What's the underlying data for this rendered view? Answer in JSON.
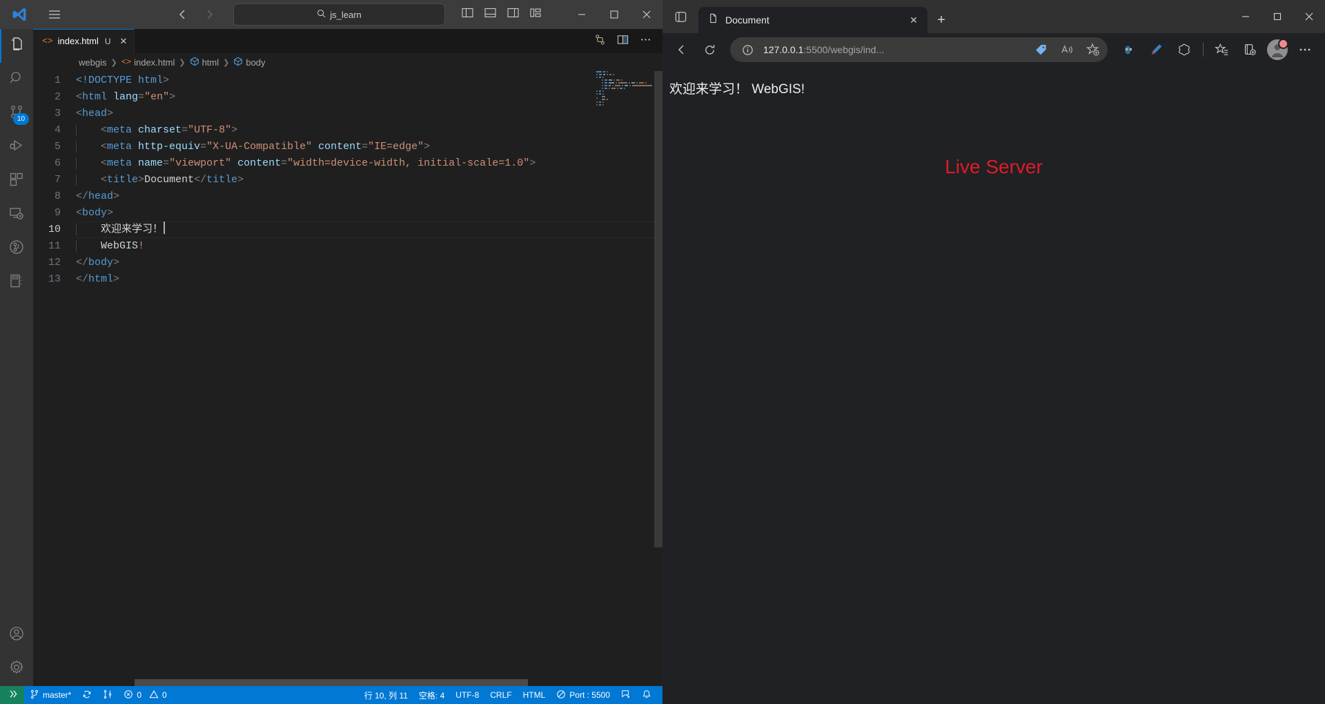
{
  "vscode": {
    "titlebar": {
      "search_value": "js_learn",
      "search_icon": "search-icon",
      "hamburger_icon": "hamburger-menu-icon",
      "logo_icon": "vscode-logo-icon",
      "back_icon": "back-arrow-icon",
      "forward_icon": "forward-arrow-icon",
      "layout_icons": [
        "toggle-primary-sidebar-icon",
        "toggle-panel-icon",
        "toggle-secondary-sidebar-icon",
        "customize-layout-icon"
      ],
      "window_controls": [
        "minimize",
        "maximize",
        "close"
      ]
    },
    "activitybar": {
      "items": [
        {
          "name": "explorer",
          "icon": "files-icon",
          "active": true,
          "badge": ""
        },
        {
          "name": "search",
          "icon": "search-icon",
          "active": false,
          "badge": ""
        },
        {
          "name": "source-control",
          "icon": "source-control-icon",
          "active": false,
          "badge": "10"
        },
        {
          "name": "run-and-debug",
          "icon": "run-debug-icon",
          "active": false,
          "badge": ""
        },
        {
          "name": "extensions",
          "icon": "extensions-icon",
          "active": false,
          "badge": ""
        },
        {
          "name": "remote-explorer",
          "icon": "remote-explorer-icon",
          "active": false,
          "badge": ""
        },
        {
          "name": "git-graph",
          "icon": "git-graph-icon",
          "active": false,
          "badge": ""
        },
        {
          "name": "notebook",
          "icon": "notebook-icon",
          "active": false,
          "badge": ""
        }
      ],
      "bottom_items": [
        {
          "name": "accounts",
          "icon": "account-icon"
        },
        {
          "name": "manage",
          "icon": "gear-icon"
        }
      ]
    },
    "tab": {
      "label": "index.html",
      "dirty_indicator": "U",
      "close_label": "✕",
      "file_icon": "html-file-icon",
      "actions": [
        "split-editor-down-icon",
        "split-editor-right-icon",
        "more-actions-icon"
      ]
    },
    "breadcrumbs": [
      {
        "label": "webgis",
        "icon": ""
      },
      {
        "label": "index.html",
        "icon": "html-file-icon"
      },
      {
        "label": "html",
        "icon": "symbol-field-icon"
      },
      {
        "label": "body",
        "icon": "symbol-field-icon"
      }
    ],
    "code": {
      "lines": [
        {
          "n": "1",
          "indent": 0,
          "tokens": [
            {
              "t": "doctype",
              "v": "<!DOCTYPE "
            },
            {
              "t": "tag",
              "v": "html"
            },
            {
              "t": "punct",
              "v": ">"
            }
          ]
        },
        {
          "n": "2",
          "indent": 0,
          "tokens": [
            {
              "t": "punct",
              "v": "<"
            },
            {
              "t": "tag",
              "v": "html "
            },
            {
              "t": "attr",
              "v": "lang"
            },
            {
              "t": "punct",
              "v": "="
            },
            {
              "t": "str",
              "v": "\"en\""
            },
            {
              "t": "punct",
              "v": ">"
            }
          ]
        },
        {
          "n": "3",
          "indent": 0,
          "tokens": [
            {
              "t": "punct",
              "v": "<"
            },
            {
              "t": "tag",
              "v": "head"
            },
            {
              "t": "punct",
              "v": ">"
            }
          ]
        },
        {
          "n": "4",
          "indent": 1,
          "tokens": [
            {
              "t": "punct",
              "v": "<"
            },
            {
              "t": "tag",
              "v": "meta "
            },
            {
              "t": "attr",
              "v": "charset"
            },
            {
              "t": "punct",
              "v": "="
            },
            {
              "t": "str",
              "v": "\"UTF-8\""
            },
            {
              "t": "punct",
              "v": ">"
            }
          ]
        },
        {
          "n": "5",
          "indent": 1,
          "tokens": [
            {
              "t": "punct",
              "v": "<"
            },
            {
              "t": "tag",
              "v": "meta "
            },
            {
              "t": "attr",
              "v": "http-equiv"
            },
            {
              "t": "punct",
              "v": "="
            },
            {
              "t": "str",
              "v": "\"X-UA-Compatible\""
            },
            {
              "t": "txt",
              "v": " "
            },
            {
              "t": "attr",
              "v": "content"
            },
            {
              "t": "punct",
              "v": "="
            },
            {
              "t": "str",
              "v": "\"IE=edge\""
            },
            {
              "t": "punct",
              "v": ">"
            }
          ]
        },
        {
          "n": "6",
          "indent": 1,
          "tokens": [
            {
              "t": "punct",
              "v": "<"
            },
            {
              "t": "tag",
              "v": "meta "
            },
            {
              "t": "attr",
              "v": "name"
            },
            {
              "t": "punct",
              "v": "="
            },
            {
              "t": "str",
              "v": "\"viewport\""
            },
            {
              "t": "txt",
              "v": " "
            },
            {
              "t": "attr",
              "v": "content"
            },
            {
              "t": "punct",
              "v": "="
            },
            {
              "t": "str",
              "v": "\"width=device-width, initial-scale=1.0\""
            },
            {
              "t": "punct",
              "v": ">"
            }
          ]
        },
        {
          "n": "7",
          "indent": 1,
          "tokens": [
            {
              "t": "punct",
              "v": "<"
            },
            {
              "t": "tag",
              "v": "title"
            },
            {
              "t": "punct",
              "v": ">"
            },
            {
              "t": "white",
              "v": "Document"
            },
            {
              "t": "punct",
              "v": "</"
            },
            {
              "t": "tag",
              "v": "title"
            },
            {
              "t": "punct",
              "v": ">"
            }
          ]
        },
        {
          "n": "8",
          "indent": 0,
          "tokens": [
            {
              "t": "punct",
              "v": "</"
            },
            {
              "t": "tag",
              "v": "head"
            },
            {
              "t": "punct",
              "v": ">"
            }
          ]
        },
        {
          "n": "9",
          "indent": 0,
          "tokens": [
            {
              "t": "punct",
              "v": "<"
            },
            {
              "t": "tag",
              "v": "body"
            },
            {
              "t": "punct",
              "v": ">"
            }
          ]
        },
        {
          "n": "10",
          "indent": 1,
          "current": true,
          "tokens": [
            {
              "t": "white",
              "v": "欢迎来学习！"
            }
          ],
          "caret": true
        },
        {
          "n": "11",
          "indent": 1,
          "tokens": [
            {
              "t": "white",
              "v": "WebGIS"
            },
            {
              "t": "str",
              "v": "!"
            }
          ]
        },
        {
          "n": "12",
          "indent": 0,
          "tokens": [
            {
              "t": "punct",
              "v": "</"
            },
            {
              "t": "tag",
              "v": "body"
            },
            {
              "t": "punct",
              "v": ">"
            }
          ]
        },
        {
          "n": "13",
          "indent": 0,
          "tokens": [
            {
              "t": "punct",
              "v": "</"
            },
            {
              "t": "tag",
              "v": "html"
            },
            {
              "t": "punct",
              "v": ">"
            }
          ]
        }
      ]
    },
    "statusbar": {
      "remote_icon": "remote-window-icon",
      "branch_icon": "source-control-branch-icon",
      "branch": "master*",
      "sync_icon": "sync-icon",
      "prs_icon": "pull-request-icon",
      "errors_icon": "error-icon",
      "errors": "0",
      "warnings_icon": "warning-icon",
      "warnings": "0",
      "cursor_position": "行 10, 列 11",
      "indentation": "空格: 4",
      "encoding": "UTF-8",
      "eol": "CRLF",
      "language": "HTML",
      "live_server": "Port : 5500",
      "live_server_icon": "broadcast-icon",
      "feedback_icon": "feedback-icon",
      "bell_icon": "bell-icon",
      "accent_color": "#0078d4",
      "remote_color": "#16825d"
    }
  },
  "edge": {
    "tab_search_icon": "tab-search-icon",
    "tab": {
      "title": "Document",
      "favicon": "page-icon",
      "close_label": "✕"
    },
    "new_tab_label": "+",
    "window_controls": {
      "minimize": "─",
      "maximize": "❐",
      "close": "✕"
    },
    "toolbar": {
      "back_icon": "back-arrow-icon",
      "refresh_icon": "refresh-icon",
      "site_info_icon": "info-circle-icon",
      "url_primary": "127.0.0.1",
      "url_secondary": ":5500/webgis/ind...",
      "shopping_icon": "price-tag-icon",
      "read_aloud_icon": "read-aloud-icon",
      "favorite_icon": "add-favorite-icon",
      "actions": [
        {
          "name": "split-screen-icon"
        },
        {
          "name": "collections-pen-icon"
        },
        {
          "name": "browser-essentials-icon"
        }
      ],
      "favorites_icon": "favorites-list-icon",
      "collections_icon": "collections-icon",
      "profile_icon": "profile-avatar-icon",
      "settings_icon": "more-options-icon"
    },
    "page": {
      "heading": "欢迎来学习！  WebGIS!",
      "live_server_text": "Live Server",
      "live_server_color": "#e01b24",
      "background_color": "#202124"
    }
  }
}
